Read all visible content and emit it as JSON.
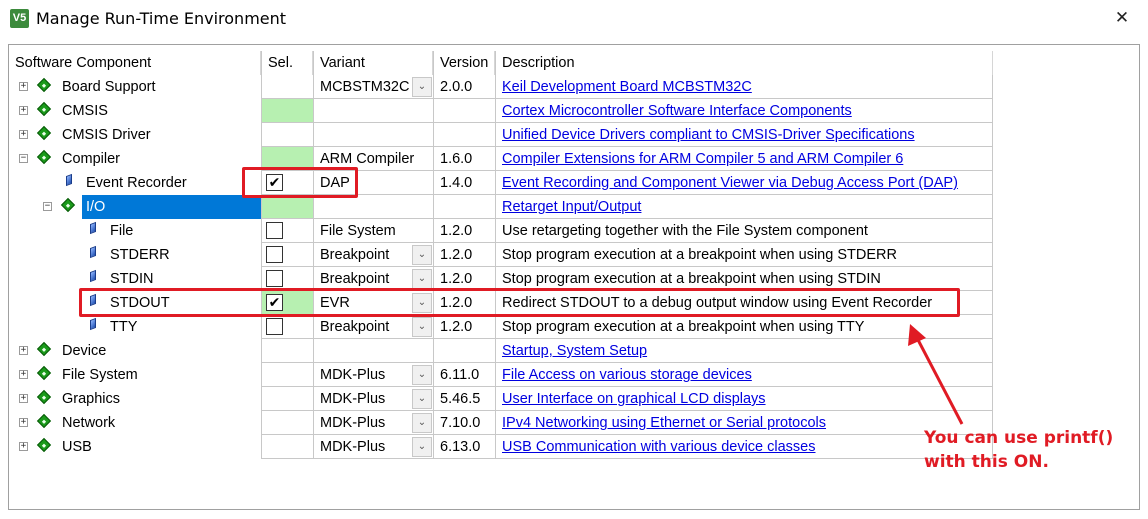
{
  "window": {
    "title": "Manage Run-Time Environment",
    "icon_text": "V5",
    "close_glyph": "✕"
  },
  "columns": {
    "component": "Software Component",
    "sel": "Sel.",
    "variant": "Variant",
    "version": "Version",
    "description": "Description"
  },
  "rows": [
    {
      "label": "Board Support",
      "sel": "",
      "variant": "MCBSTM32C",
      "variant_dropdown": true,
      "version": "2.0.0",
      "description": "Keil Development Board MCBSTM32C",
      "link": true
    },
    {
      "label": "CMSIS",
      "sel": "green",
      "variant": "",
      "version": "",
      "description": "Cortex Microcontroller Software Interface Components",
      "link": true
    },
    {
      "label": "CMSIS Driver",
      "sel": "",
      "variant": "",
      "version": "",
      "description": "Unified Device Drivers compliant to CMSIS-Driver Specifications",
      "link": true
    },
    {
      "label": "Compiler",
      "sel": "green",
      "variant": "ARM Compiler",
      "version": "1.6.0",
      "description": "Compiler Extensions for ARM Compiler 5 and ARM Compiler 6",
      "link": true
    },
    {
      "label": "Event Recorder",
      "sel": "checked",
      "variant": "DAP",
      "version": "1.4.0",
      "description": "Event Recording and Component Viewer via Debug Access Port (DAP)",
      "link": true
    },
    {
      "label": "I/O",
      "sel": "green",
      "variant": "",
      "version": "",
      "description": "Retarget Input/Output",
      "link": true
    },
    {
      "label": "File",
      "sel": "unchecked",
      "variant": "File System",
      "version": "1.2.0",
      "description": "Use retargeting together with the File System component",
      "link": false
    },
    {
      "label": "STDERR",
      "sel": "unchecked",
      "variant": "Breakpoint",
      "variant_dropdown": true,
      "version": "1.2.0",
      "description": "Stop program execution at a breakpoint when using STDERR",
      "link": false
    },
    {
      "label": "STDIN",
      "sel": "unchecked",
      "variant": "Breakpoint",
      "variant_dropdown": true,
      "version": "1.2.0",
      "description": "Stop program execution at a breakpoint when using STDIN",
      "link": false
    },
    {
      "label": "STDOUT",
      "sel": "checked",
      "variant": "EVR",
      "variant_dropdown": true,
      "version": "1.2.0",
      "description": "Redirect STDOUT to a debug output window using Event Recorder",
      "link": false
    },
    {
      "label": "TTY",
      "sel": "unchecked",
      "variant": "Breakpoint",
      "variant_dropdown": true,
      "version": "1.2.0",
      "description": "Stop program execution at a breakpoint when using TTY",
      "link": false
    },
    {
      "label": "Device",
      "sel": "",
      "variant": "",
      "version": "",
      "description": "Startup, System Setup",
      "link": true
    },
    {
      "label": "File System",
      "sel": "",
      "variant": "MDK-Plus",
      "variant_dropdown": true,
      "version": "6.11.0",
      "description": "File Access on various storage devices",
      "link": true
    },
    {
      "label": "Graphics",
      "sel": "",
      "variant": "MDK-Plus",
      "variant_dropdown": true,
      "version": "5.46.5",
      "description": "User Interface on graphical LCD displays",
      "link": true
    },
    {
      "label": "Network",
      "sel": "",
      "variant": "MDK-Plus",
      "variant_dropdown": true,
      "version": "7.10.0",
      "description": "IPv4 Networking using Ethernet or Serial protocols",
      "link": true
    },
    {
      "label": "USB",
      "sel": "",
      "variant": "MDK-Plus",
      "variant_dropdown": true,
      "version": "6.13.0",
      "description": "USB Communication with various device classes",
      "link": true
    }
  ],
  "glyphs": {
    "expand": "+",
    "collapse": "−",
    "check": "✔",
    "dropdown": "⌄"
  },
  "annotation": {
    "line1": "You can use printf()",
    "line2": "with this ON.",
    "color": "#e01b24"
  },
  "colors": {
    "selected_row": "#0078d7",
    "green_cell": "#b7f0b1",
    "link": "#0000e0"
  }
}
